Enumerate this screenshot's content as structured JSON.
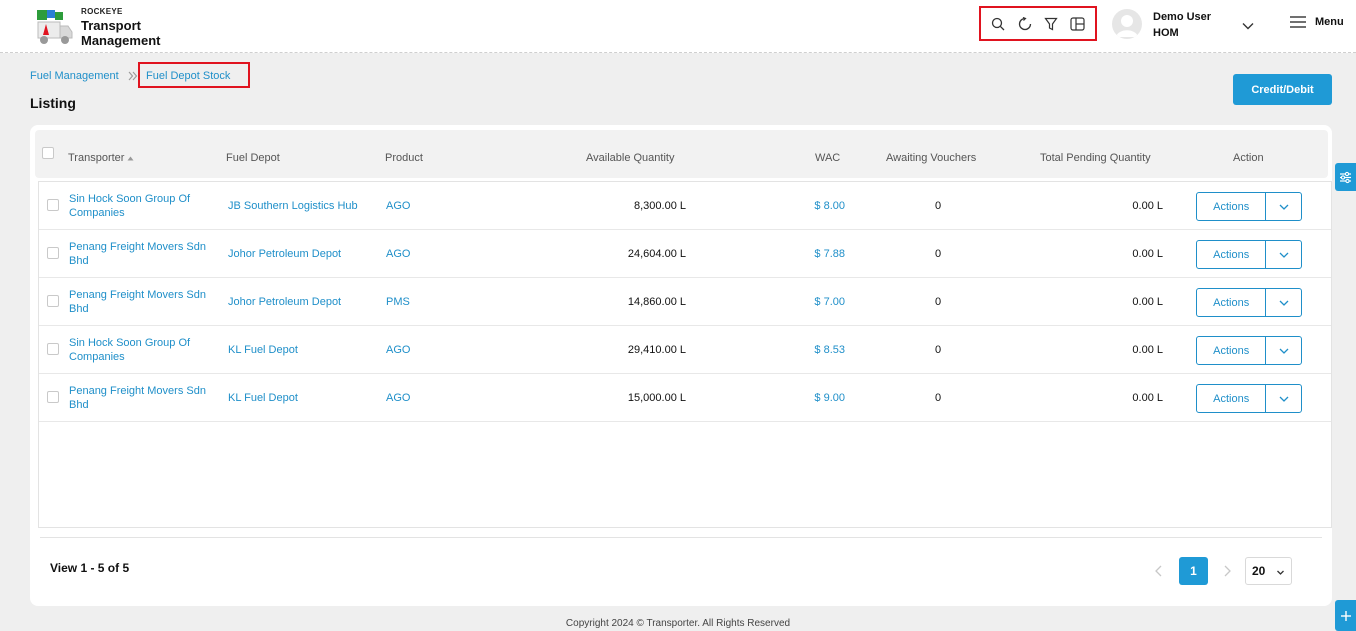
{
  "header": {
    "brand_small": "ROCKEYE",
    "brand_line1": "Transport",
    "brand_line2": "Management",
    "user_name": "Demo User",
    "user_role": "HOM",
    "menu_label": "Menu"
  },
  "breadcrumb": {
    "parent": "Fuel Management",
    "current": "Fuel Depot Stock"
  },
  "page": {
    "title": "Listing",
    "credit_debit_label": "Credit/Debit"
  },
  "table": {
    "columns": [
      "Transporter",
      "Fuel Depot",
      "Product",
      "Available Quantity",
      "WAC",
      "Awaiting Vouchers",
      "Total Pending Quantity",
      "Action"
    ],
    "action_label": "Actions",
    "rows": [
      {
        "transporter_l1": "Sin Hock Soon Group Of",
        "transporter_l2": "Companies",
        "depot": "JB Southern Logistics Hub",
        "product": "AGO",
        "available": "8,300.00 L",
        "wac": "$ 8.00",
        "awaiting": "0",
        "pending": "0.00 L"
      },
      {
        "transporter_l1": "Penang Freight Movers Sdn",
        "transporter_l2": "Bhd",
        "depot": "Johor Petroleum Depot",
        "product": "AGO",
        "available": "24,604.00 L",
        "wac": "$ 7.88",
        "awaiting": "0",
        "pending": "0.00 L"
      },
      {
        "transporter_l1": "Penang Freight Movers Sdn",
        "transporter_l2": "Bhd",
        "depot": "Johor Petroleum Depot",
        "product": "PMS",
        "available": "14,860.00 L",
        "wac": "$ 7.00",
        "awaiting": "0",
        "pending": "0.00 L"
      },
      {
        "transporter_l1": "Sin Hock Soon Group Of",
        "transporter_l2": "Companies",
        "depot": "KL Fuel Depot",
        "product": "AGO",
        "available": "29,410.00 L",
        "wac": "$ 8.53",
        "awaiting": "0",
        "pending": "0.00 L"
      },
      {
        "transporter_l1": "Penang Freight Movers Sdn",
        "transporter_l2": "Bhd",
        "depot": "KL Fuel Depot",
        "product": "AGO",
        "available": "15,000.00 L",
        "wac": "$ 9.00",
        "awaiting": "0",
        "pending": "0.00 L"
      }
    ]
  },
  "pagination": {
    "view_text": "View 1 - 5 of 5",
    "current_page": "1",
    "per_page": "20"
  },
  "footer": {
    "copyright": "Copyright 2024 © Transporter. All Rights Reserved"
  },
  "icons": {
    "toolbar": [
      "search-icon",
      "refresh-icon",
      "filter-icon",
      "columns-icon"
    ],
    "sort": "sort-up-icon",
    "side": [
      "settings-sliders-icon",
      "plus-icon"
    ]
  },
  "colors": {
    "accent": "#1f9ad6",
    "link": "#1f8fc9",
    "highlight": "#e0131f"
  }
}
